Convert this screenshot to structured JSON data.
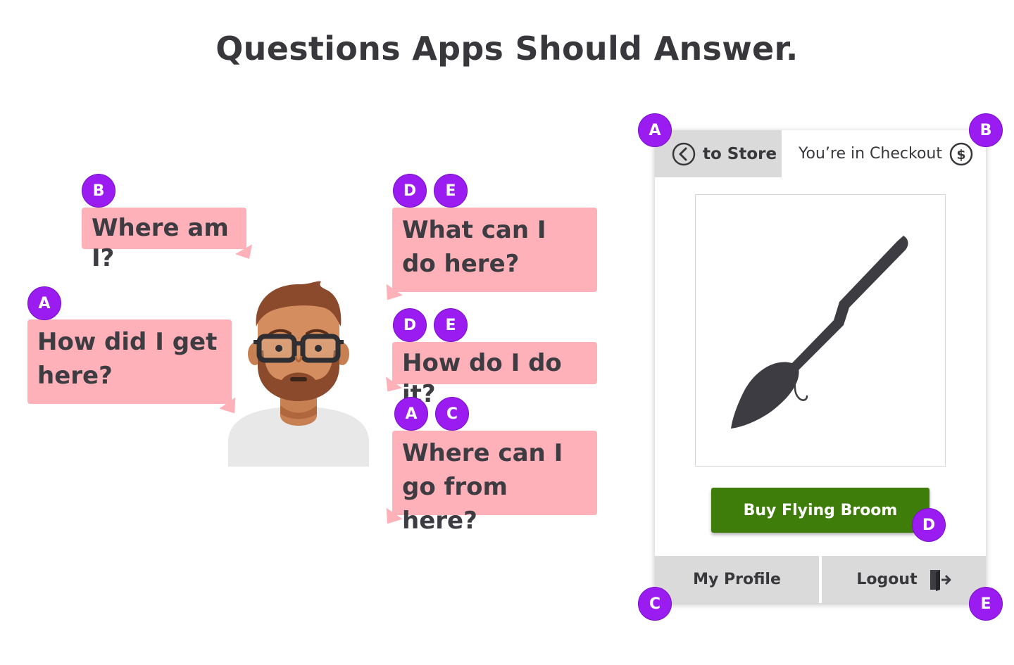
{
  "title": "Questions Apps Should Answer.",
  "questions": {
    "where_am_i": "Where am I?",
    "how_did_i_get_here": "How did I get here?",
    "what_can_i_do": "What can I do here?",
    "how_do_i_do_it": "How do I do it?",
    "where_can_i_go": "Where can I go from here?"
  },
  "badges": {
    "a": "A",
    "b": "B",
    "c": "C",
    "d": "D",
    "e": "E"
  },
  "app": {
    "back_tab_label": "to Store",
    "current_tab_label": "You’re in Checkout",
    "buy_button_label": "Buy Flying Broom",
    "profile_tab_label": "My Profile",
    "logout_tab_label": "Logout",
    "product_icon": "broom-icon"
  },
  "colors": {
    "bubble": "#ffb1b9",
    "badge": "#9b1cf0",
    "buy_button": "#3f7d0b",
    "tab_gray": "#dadada",
    "text": "#38383c"
  }
}
